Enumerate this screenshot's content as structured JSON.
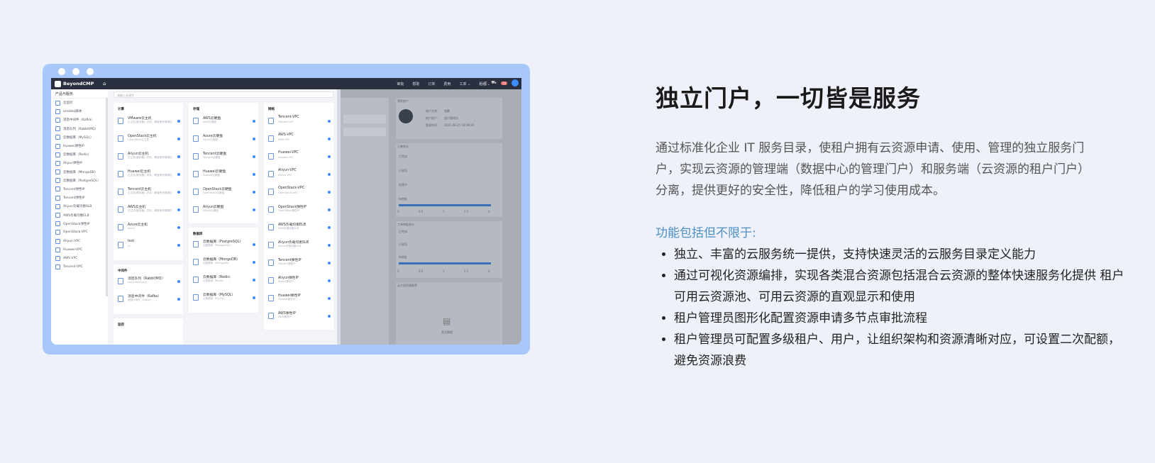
{
  "app": {
    "logo": "BeyondCMP",
    "nav": [
      "审批",
      "帮助",
      "订单",
      "费用",
      "工单 ⌄",
      "租组 ⌄"
    ],
    "badge_count": "10"
  },
  "sidebar": {
    "header": "产品与服务",
    "items": [
      "云监控",
      "ansiblej脚本",
      "消息中间件（Kafka）",
      "消息队列（RabbitMQ）",
      "云数据库（MySQL）",
      "Huawei弹性IP",
      "云数据库（Redis）",
      "Aliyun弹性IP",
      "云数据库（MongoDB）",
      "云数据库（PostgreSQL）",
      "Tencent弹性IP",
      "Tencent弹性IP",
      "Aliyun负载均衡SLB",
      "AWS负载均衡ELB",
      "OpenStack弹性IP",
      "OpenStack-VPC",
      "Aliyun-VPC",
      "Huawei-VPC",
      "AWS-VPC",
      "Tencent-VPC"
    ]
  },
  "panel": {
    "search_placeholder": "请输入关键字",
    "compute": {
      "title": "计算",
      "items": [
        {
          "name": "VMware云主机",
          "sub": "云主机(服务器), 内存、硬盘等资源弹性伸缩"
        },
        {
          "name": "OpenStack云主机",
          "sub": "OpenStack云主机"
        },
        {
          "name": "Aliyun云主机",
          "sub": "云主机(服务器), 内存、硬盘等资源弹性伸缩"
        },
        {
          "name": "Huawei云主机",
          "sub": "云主机(服务器), 内存、硬盘等资源弹性伸缩"
        },
        {
          "name": "Tencent云主机",
          "sub": "云主机(服务器), 内存、硬盘等资源弹性伸缩"
        },
        {
          "name": "AWS云主机",
          "sub": "云主机(服务器), 内存、硬盘等资源弹性伸缩"
        },
        {
          "name": "Azure云主机",
          "sub": "azure"
        },
        {
          "name": "test",
          "sub": "t1"
        }
      ]
    },
    "storage": {
      "title": "存储",
      "items": [
        {
          "name": "AWS云硬盘",
          "sub": "AWS云硬盘"
        },
        {
          "name": "Azure云硬盘",
          "sub": "Azure云硬盘"
        },
        {
          "name": "Tencent云硬盘",
          "sub": "Tencent云硬盘"
        },
        {
          "name": "Huawei云硬盘",
          "sub": "Huawei云硬盘"
        },
        {
          "name": "OpenStack云硬盘",
          "sub": "OpenStack云硬盘"
        },
        {
          "name": "Aliyun云硬盘",
          "sub": "Aliyun云硬盘"
        }
      ]
    },
    "database": {
      "title": "数据库",
      "items": [
        {
          "name": "云数据库（PostgreSQL）",
          "sub": "云数据库（PostgreSQL）"
        },
        {
          "name": "云数据库（MongoDB）",
          "sub": "云数据库（MongoDB）"
        },
        {
          "name": "云数据库（Redis）",
          "sub": "云数据库（Redis）"
        },
        {
          "name": "云数据库（MySQL）",
          "sub": "云数据库（MySQL）"
        }
      ]
    },
    "middleware": {
      "title": "中间件",
      "items": [
        {
          "name": "消息队列（RabbitMQ）",
          "sub": "consultdelivery"
        },
        {
          "name": "消息中间件（Kafka）",
          "sub": "消息中间件（Kafka）"
        }
      ]
    },
    "monitor": {
      "title": "监控"
    },
    "network": {
      "title": "网络",
      "items": [
        {
          "name": "Tencent-VPC",
          "sub": "Tencent-VPC"
        },
        {
          "name": "AWS-VPC",
          "sub": "AWS-VPC"
        },
        {
          "name": "Huawei-VPC",
          "sub": "Huawei-VPC"
        },
        {
          "name": "Aliyun-VPC",
          "sub": "Aliyun-VPC"
        },
        {
          "name": "OpenStack-VPC",
          "sub": "OpenStack-VPC"
        },
        {
          "name": "OpenStack弹性IP",
          "sub": "OpenStack弹性IP"
        },
        {
          "name": "AWS负载均衡ELB",
          "sub": "AWS负载均衡ELB"
        },
        {
          "name": "Aliyun负载均衡SLB",
          "sub": "Aliyun负载均衡SLB"
        },
        {
          "name": "Tencent弹性IP",
          "sub": "Tencent弹性IP"
        },
        {
          "name": "Aliyun弹性IP",
          "sub": "Aliyun弹性IP"
        },
        {
          "name": "Huawei弹性IP",
          "sub": "Huawei弹性IP"
        },
        {
          "name": "AWS弹性IP",
          "sub": "AWS弹性IP"
        }
      ]
    }
  },
  "overlay": {
    "user_label": "我的账户",
    "account_name_label": "账户名称：",
    "account_name": "张鹏",
    "tenant_label": "账户租户：",
    "tenant": "租户管理员",
    "login_label": "登录时间：",
    "login_time": "2021-08-25 18:08:30",
    "order_stats": "订单统计",
    "rows": [
      "已完成",
      "已驳回",
      "处理中",
      "待审批"
    ],
    "axis": [
      "0",
      "0.5",
      "1",
      "1.5",
      "2"
    ],
    "approval_stats": "工单审批统计",
    "rows2": [
      "已完成",
      "已驳回",
      "待审批"
    ],
    "rec": "云主机资源推荐",
    "empty": "暂无数据"
  },
  "content": {
    "title": "独立门户，一切皆是服务",
    "description": "通过标准化企业 IT 服务目录，使租户拥有云资源申请、使用、管理的独立服务门户，实现云资源的管理端（数据中心的管理门户）和服务端（云资源的租户门户）分离，提供更好的安全性，降低租户的学习使用成本。",
    "subheading": "功能包括但不限于:",
    "features": [
      "独立、丰富的云服务统一提供，支持快速灵活的云服务目录定义能力",
      "通过可视化资源编排，实现各类混合资源包括混合云资源的整体快速服务化提供 租户可用云资源池、可用云资源的直观显示和使用",
      "租户管理员图形化配置资源申请多节点审批流程",
      "租户管理员可配置多级租户、用户，让组织架构和资源清晰对应，可设置二次配额，避免资源浪费"
    ]
  }
}
